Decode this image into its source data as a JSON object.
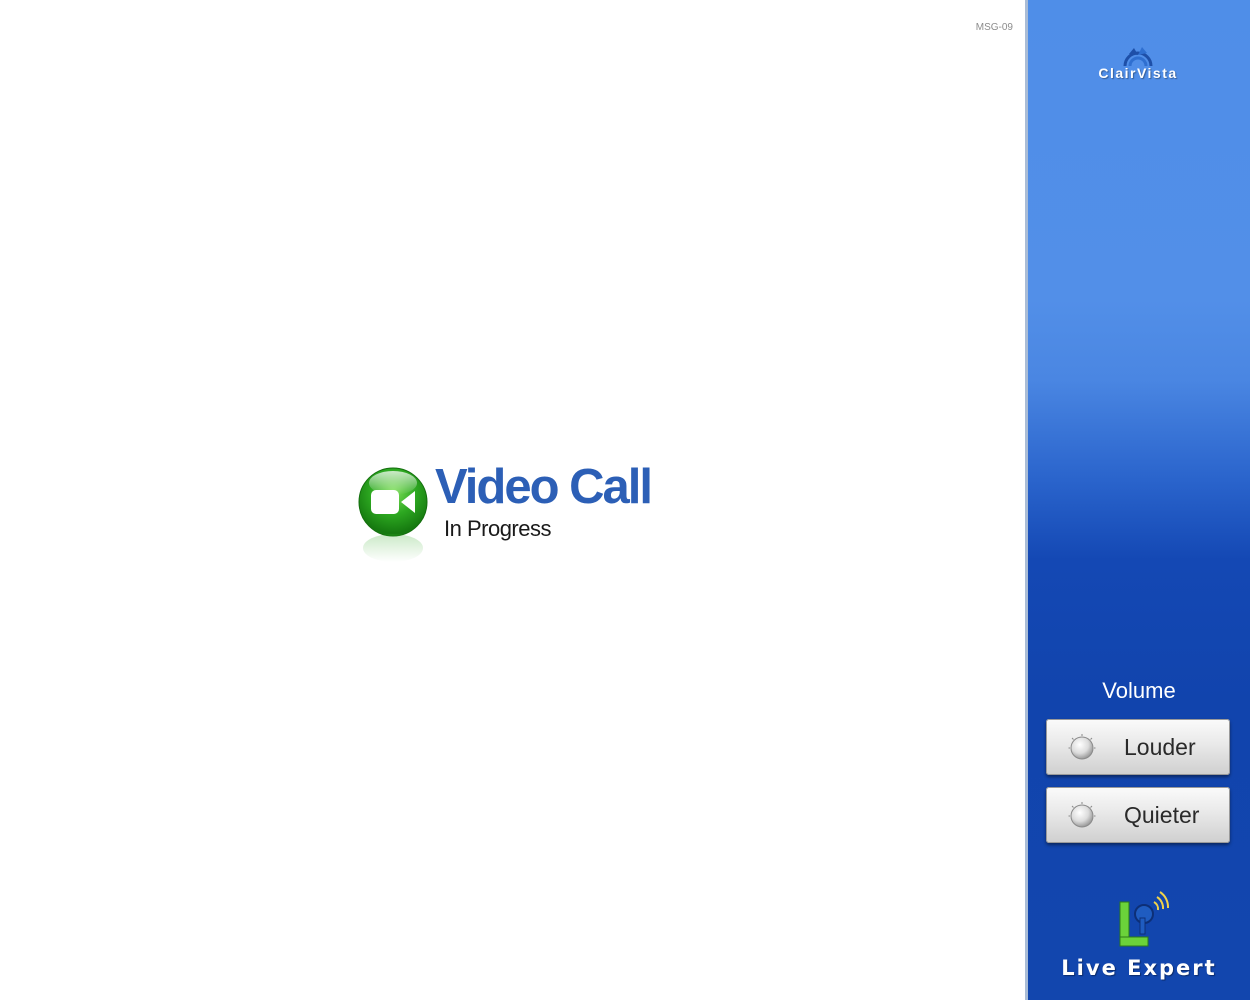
{
  "screen_code": "MSG-09",
  "call_status": {
    "title": "Video Call",
    "subtitle": "In Progress",
    "icon": "video-camera-icon"
  },
  "sidebar": {
    "brand_name": "ClairVista",
    "volume": {
      "label": "Volume",
      "louder_label": "Louder",
      "quieter_label": "Quieter"
    },
    "live_expert_label": "Live Expert"
  },
  "colors": {
    "title_blue": "#2c5fb6",
    "icon_green": "#2da821",
    "sidebar_blue": "#1448b4"
  }
}
